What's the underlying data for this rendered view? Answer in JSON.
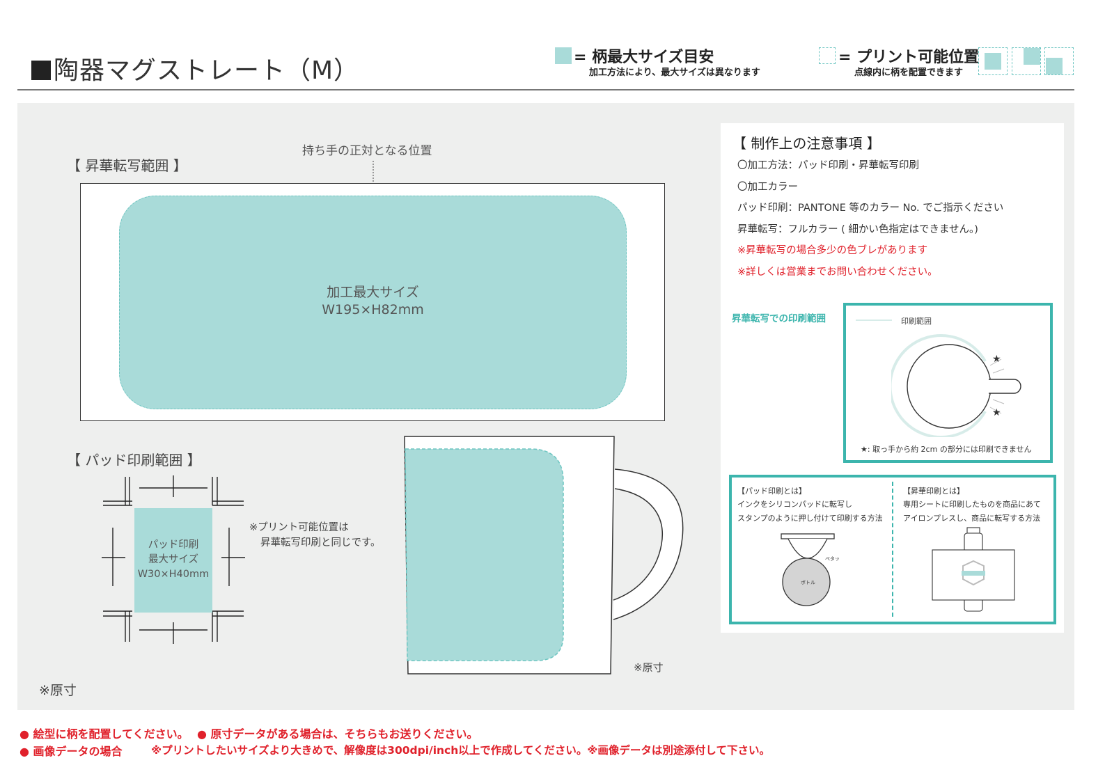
{
  "header": {
    "title": "陶器マグストレート（M）",
    "legend_max": {
      "label": "= 柄最大サイズ目安",
      "sub": "加工方法により、最大サイズは異なります"
    },
    "legend_print": {
      "label": "= プリント可能位置",
      "sub": "点線内に柄を配置できます"
    }
  },
  "sublimation": {
    "section_label": "【 昇華転写範囲 】",
    "handle_note": "持ち手の正対となる位置",
    "area_title": "加工最大サイズ",
    "area_size": "W195×H82mm"
  },
  "pad": {
    "section_label": "【 パッド印刷範囲 】",
    "area_line1": "パッド印刷",
    "area_line2": "最大サイズ",
    "area_size": "W30×H40mm",
    "note_line1": "※プリント可能位置は",
    "note_line2": "昇華転写印刷と同じです。"
  },
  "original_size_left": "※原寸",
  "original_size_mug": "※原寸",
  "notes": {
    "title": "【 制作上の注意事項 】",
    "lines": [
      "〇加工方法：パッド印刷・昇華転写印刷",
      "〇加工カラー",
      "パッド印刷：PANTONE 等のカラー No. でご指示ください",
      "昇華転写：フルカラー ( 細かい色指定はできません。)"
    ],
    "red_lines": [
      "※昇華転写の場合多少の色ブレがあります",
      "※詳しくは営業までお問い合わせください。"
    ]
  },
  "top_view": {
    "label": "昇華転写での印刷範囲",
    "legend": "印刷範囲",
    "star": "★",
    "footnote": "★: 取っ手から約 2cm の部分には印刷できません"
  },
  "methods": {
    "pad_title": "【パッド印刷とは】",
    "pad_line1": "インクをシリコンパッドに転写し",
    "pad_line2": "スタンプのように押し付けて印刷する方法",
    "pad_label_a": "ペタッ",
    "pad_label_b": "ボトル",
    "sub_title": "【昇華印刷とは】",
    "sub_line1": "専用シートに印刷したものを商品にあて",
    "sub_line2": "アイロンプレスし、商品に転写する方法"
  },
  "footer": {
    "line1a": "● 絵型に柄を配置してください。",
    "line1b": "● 原寸データがある場合は、そちらもお送りください。",
    "line2a": "● 画像データの場合",
    "line2b": "※プリントしたいサイズより大きめで、解像度は300dpi/inch以上で作成してください。※画像データは別途添付して下さい。"
  },
  "colors": {
    "teal_fill": "#a9dbd9",
    "teal_border": "#3cb5ad",
    "red": "#e0212b",
    "panel_bg": "#eeefee"
  }
}
